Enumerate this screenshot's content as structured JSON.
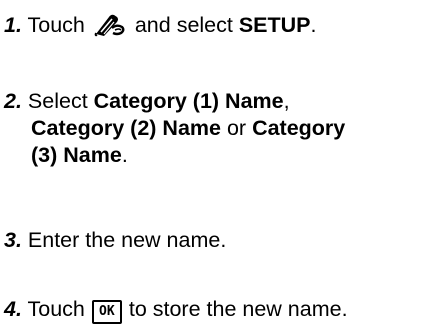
{
  "steps": [
    {
      "number": "1.",
      "text_a": " Touch ",
      "icon": "wand-menu-icon",
      "text_b": " and select ",
      "bold_a": "SETUP",
      "text_c": "."
    },
    {
      "number": "2.",
      "text_a": " Select ",
      "bold_a": "Category (1) Name",
      "text_b": ",",
      "bold_b": "Category (2) Name",
      "text_c": " or ",
      "bold_c": "Category",
      "bold_d": "(3) Name",
      "text_d": "."
    },
    {
      "number": "3.",
      "text_a": " Enter the new name."
    },
    {
      "number": "4.",
      "text_a": " Touch ",
      "key_label": "OK",
      "text_b": " to store the new name."
    }
  ]
}
